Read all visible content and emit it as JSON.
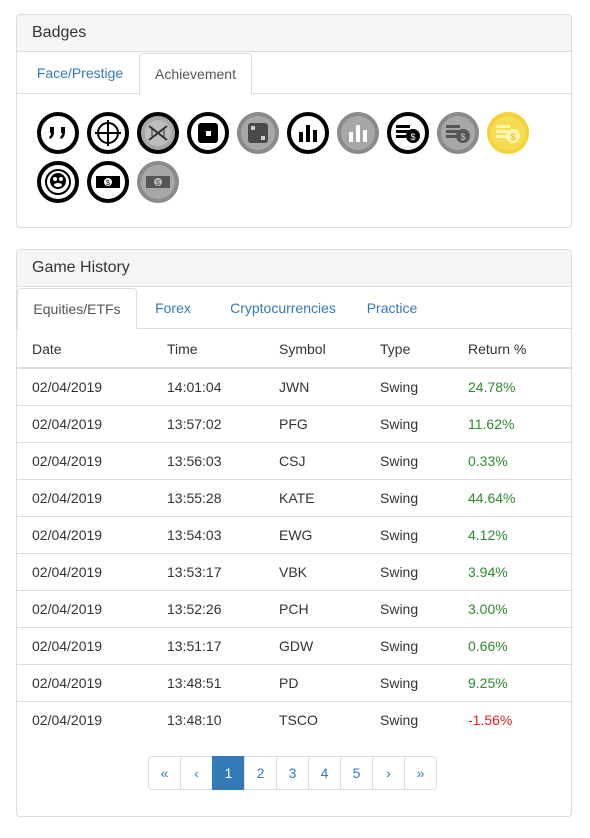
{
  "badges_panel": {
    "title": "Badges",
    "tabs": [
      {
        "label": "Face/Prestige"
      },
      {
        "label": "Achievement"
      }
    ]
  },
  "badges": [
    {
      "icon": "quote-icon",
      "state": "earned"
    },
    {
      "icon": "crosshair-icon",
      "state": "earned"
    },
    {
      "icon": "dna-icon",
      "state": "gray"
    },
    {
      "icon": "dice-one-icon",
      "state": "earned"
    },
    {
      "icon": "dice-two-icon",
      "state": "gray"
    },
    {
      "icon": "bar-chart-icon",
      "state": "earned"
    },
    {
      "icon": "bar-chart-gray-icon",
      "state": "gray"
    },
    {
      "icon": "coin-stack-icon",
      "state": "earned"
    },
    {
      "icon": "coin-stack-gray-icon",
      "state": "gray"
    },
    {
      "icon": "coin-stack-gold-icon",
      "state": "gold"
    },
    {
      "icon": "monkey-face-icon",
      "state": "earned"
    },
    {
      "icon": "banknote-icon",
      "state": "earned"
    },
    {
      "icon": "banknote-gray-icon",
      "state": "gray"
    }
  ],
  "history_panel": {
    "title": "Game History",
    "tabs": [
      {
        "label": "Equities/ETFs"
      },
      {
        "label": "Forex"
      },
      {
        "label": "Cryptocurrencies"
      },
      {
        "label": "Practice"
      }
    ],
    "columns": [
      "Date",
      "Time",
      "Symbol",
      "Type",
      "Return %"
    ],
    "rows": [
      {
        "date": "02/04/2019",
        "time": "14:01:04",
        "symbol": "JWN",
        "type": "Swing",
        "ret": "24.78%"
      },
      {
        "date": "02/04/2019",
        "time": "13:57:02",
        "symbol": "PFG",
        "type": "Swing",
        "ret": "11.62%"
      },
      {
        "date": "02/04/2019",
        "time": "13:56:03",
        "symbol": "CSJ",
        "type": "Swing",
        "ret": "0.33%"
      },
      {
        "date": "02/04/2019",
        "time": "13:55:28",
        "symbol": "KATE",
        "type": "Swing",
        "ret": "44.64%"
      },
      {
        "date": "02/04/2019",
        "time": "13:54:03",
        "symbol": "EWG",
        "type": "Swing",
        "ret": "4.12%"
      },
      {
        "date": "02/04/2019",
        "time": "13:53:17",
        "symbol": "VBK",
        "type": "Swing",
        "ret": "3.94%"
      },
      {
        "date": "02/04/2019",
        "time": "13:52:26",
        "symbol": "PCH",
        "type": "Swing",
        "ret": "3.00%"
      },
      {
        "date": "02/04/2019",
        "time": "13:51:17",
        "symbol": "GDW",
        "type": "Swing",
        "ret": "0.66%"
      },
      {
        "date": "02/04/2019",
        "time": "13:48:51",
        "symbol": "PD",
        "type": "Swing",
        "ret": "9.25%"
      },
      {
        "date": "02/04/2019",
        "time": "13:48:10",
        "symbol": "TSCO",
        "type": "Swing",
        "ret": "-1.56%"
      }
    ]
  },
  "pagination": [
    "«",
    "‹",
    "1",
    "2",
    "3",
    "4",
    "5",
    "›",
    "»"
  ],
  "colors": {
    "positive": "#2e8b2e",
    "negative": "#e02020",
    "link": "#337ab7",
    "active_page": "#337ab7"
  }
}
